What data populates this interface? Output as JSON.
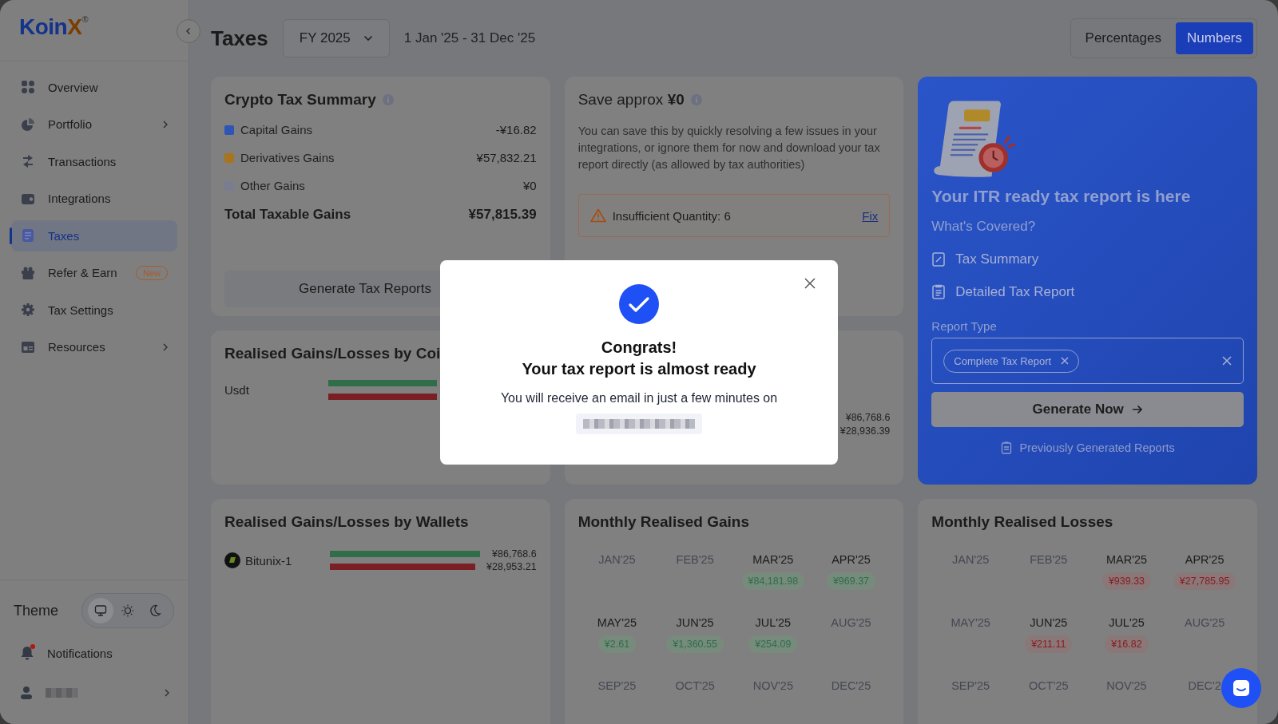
{
  "sidebar": {
    "logo": {
      "text": "Koin",
      "accent": "X",
      "mark": "®"
    },
    "items": [
      {
        "label": "Overview",
        "selected": false,
        "has_submenu": false
      },
      {
        "label": "Portfolio",
        "selected": false,
        "has_submenu": true
      },
      {
        "label": "Transactions",
        "selected": false,
        "has_submenu": false
      },
      {
        "label": "Integrations",
        "selected": false,
        "has_submenu": false
      },
      {
        "label": "Taxes",
        "selected": true,
        "has_submenu": false
      },
      {
        "label": "Refer & Earn",
        "selected": false,
        "has_submenu": false,
        "badge": "New"
      },
      {
        "label": "Tax Settings",
        "selected": false,
        "has_submenu": false
      },
      {
        "label": "Resources",
        "selected": false,
        "has_submenu": true
      }
    ],
    "theme": {
      "label": "Theme",
      "options": [
        {
          "selected": true
        },
        {
          "selected": false
        },
        {
          "selected": false
        }
      ]
    },
    "notifications": {
      "label": "Notifications",
      "unread": true
    },
    "user": {
      "has_submenu": true
    }
  },
  "header": {
    "title": "Taxes",
    "year": "FY 2025",
    "date_range": "1 Jan '25 - 31 Dec '25",
    "view_modes": [
      {
        "label": "Percentages",
        "selected": false
      },
      {
        "label": "Numbers",
        "selected": true
      }
    ]
  },
  "summary": {
    "title": "Crypto Tax Summary",
    "rows": [
      {
        "label": "Capital Gains",
        "value": "-¥16.82",
        "color": "#2d55b5"
      },
      {
        "label": "Derivatives Gains",
        "value": "¥57,832.21",
        "color": "#a8741e"
      },
      {
        "label": "Other Gains",
        "value": "¥0",
        "color": "#7a7d90"
      }
    ],
    "total": {
      "label": "Total Taxable Gains",
      "value": "¥57,815.39"
    },
    "button": "Generate Tax Reports"
  },
  "savings": {
    "title": "Save approx **¥0**",
    "description": "You can save this by quickly resolving a few issues in your integrations, or ignore them for now and download your tax report directly (as allowed by tax authorities)",
    "alert": {
      "text": "Insufficient Quantity: 6",
      "action": "Fix"
    }
  },
  "report_card": {
    "title": "Your ITR ready tax report is here",
    "covered_label": "What's Covered?",
    "covered": [
      "Tax Summary",
      "Detailed Tax Report"
    ],
    "report_type": {
      "label": "Report Type",
      "chips": [
        "Complete Tax Report"
      ]
    },
    "button": "Generate Now",
    "history_link": "Previously Generated Reports"
  },
  "coins": {
    "title": "Realised Gains/Losses by Coi",
    "rows": [
      {
        "name": "Usdt"
      }
    ]
  },
  "card_2": {
    "gain_value": "¥86,768.6",
    "loss_value": "¥28,936.39"
  },
  "wallets": {
    "title": "Realised Gains/Losses by Wallets",
    "rows": [
      {
        "name": "Bitunix-1",
        "gain": "¥86,768.6",
        "loss": "¥28,953.21"
      }
    ]
  },
  "monthly": [
    {
      "title": "Monthly Realised Gains",
      "kind": "gain",
      "months": [
        {
          "label": "JAN'25"
        },
        {
          "label": "FEB'25"
        },
        {
          "label": "MAR'25",
          "value": "¥84,181.98"
        },
        {
          "label": "APR'25",
          "value": "¥969.37"
        },
        {
          "label": "MAY'25",
          "value": "¥2.61"
        },
        {
          "label": "JUN'25",
          "value": "¥1,360.55"
        },
        {
          "label": "JUL'25",
          "value": "¥254.09"
        },
        {
          "label": "AUG'25"
        },
        {
          "label": "SEP'25"
        },
        {
          "label": "OCT'25"
        },
        {
          "label": "NOV'25"
        },
        {
          "label": "DEC'25"
        }
      ]
    },
    {
      "title": "Monthly Realised Losses",
      "kind": "loss",
      "months": [
        {
          "label": "JAN'25"
        },
        {
          "label": "FEB'25"
        },
        {
          "label": "MAR'25",
          "value": "¥939.33"
        },
        {
          "label": "APR'25",
          "value": "¥27,785.95"
        },
        {
          "label": "MAY'25"
        },
        {
          "label": "JUN'25",
          "value": "¥211.11"
        },
        {
          "label": "JUL'25",
          "value": "¥16.82"
        },
        {
          "label": "AUG'25"
        },
        {
          "label": "SEP'25"
        },
        {
          "label": "OCT'25"
        },
        {
          "label": "NOV'25"
        },
        {
          "label": "DEC'2"
        }
      ]
    }
  ],
  "modal": {
    "title": "Congrats!",
    "subtitle": "Your tax report is almost ready",
    "message": "You will receive an email in just a few minutes on"
  }
}
